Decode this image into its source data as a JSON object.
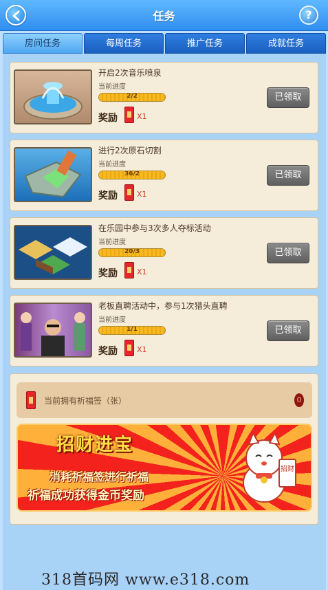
{
  "header": {
    "title": "任务",
    "help_label": "?"
  },
  "tabs": [
    {
      "label": "房间任务",
      "active": true
    },
    {
      "label": "每周任务",
      "active": false
    },
    {
      "label": "推广任务",
      "active": false
    },
    {
      "label": "成就任务",
      "active": false
    }
  ],
  "tasks": [
    {
      "title": "开启2次音乐喷泉",
      "progress_label": "当前进度",
      "progress_text": "2/2",
      "progress_fraction": 1.0,
      "reward_label": "奖励",
      "reward_count": "X1",
      "button_label": "已领取",
      "thumb": "fountain"
    },
    {
      "title": "进行2次原石切割",
      "progress_label": "当前进度",
      "progress_text": "36/2",
      "progress_fraction": 1.0,
      "reward_label": "奖励",
      "reward_count": "X1",
      "button_label": "已领取",
      "thumb": "stone-cutting"
    },
    {
      "title": "在乐园中参与3次多人夺标活动",
      "progress_label": "当前进度",
      "progress_text": "20/3",
      "progress_fraction": 1.0,
      "reward_label": "奖励",
      "reward_count": "X1",
      "button_label": "已领取",
      "thumb": "island"
    },
    {
      "title": "老板直聘活动中，参与1次猎头直聘",
      "progress_label": "当前进度",
      "progress_text": "1/1",
      "progress_fraction": 1.0,
      "reward_label": "奖励",
      "reward_count": "X1",
      "button_label": "已领取",
      "thumb": "headhunter"
    }
  ],
  "blessing": {
    "label": "当前拥有祈福签（张）",
    "count": "0"
  },
  "banner": {
    "title": "招财进宝",
    "line1": "消耗祈福签进行祈福",
    "line2": "祈福成功获得金币奖励",
    "sign_text": "招财"
  },
  "watermark": "318首码网 www.e318.com",
  "colors": {
    "header": "#2f8ef0",
    "card": "#f5ecd9",
    "claimed_button": "#6f6f6f",
    "progress": "#f7b920"
  }
}
